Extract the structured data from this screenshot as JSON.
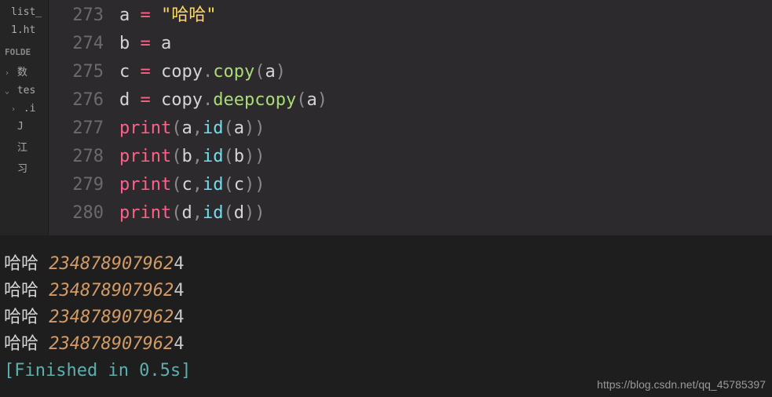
{
  "sidebar": {
    "items": [
      {
        "label": "list_",
        "type": "file"
      },
      {
        "label": "1.ht",
        "type": "file"
      },
      {
        "label": "FOLDE",
        "type": "header"
      },
      {
        "label": "数",
        "type": "folder-closed"
      },
      {
        "label": "tes",
        "type": "folder-open"
      },
      {
        "label": ".i",
        "type": "folder-closed-nested"
      },
      {
        "label": "J",
        "type": "file-nested"
      },
      {
        "label": "江",
        "type": "file-nested"
      },
      {
        "label": "习",
        "type": "file-nested"
      }
    ]
  },
  "editor": {
    "lines": [
      {
        "num": "273",
        "tokens": [
          {
            "t": "a ",
            "c": "var"
          },
          {
            "t": "=",
            "c": "op"
          },
          {
            "t": " ",
            "c": "var"
          },
          {
            "t": "\"哈哈\"",
            "c": "str"
          }
        ]
      },
      {
        "num": "274",
        "tokens": [
          {
            "t": "b ",
            "c": "var"
          },
          {
            "t": "=",
            "c": "op"
          },
          {
            "t": " a",
            "c": "var"
          }
        ]
      },
      {
        "num": "275",
        "tokens": [
          {
            "t": "c ",
            "c": "var"
          },
          {
            "t": "=",
            "c": "op"
          },
          {
            "t": " copy",
            "c": "var"
          },
          {
            "t": ".",
            "c": "punc"
          },
          {
            "t": "copy",
            "c": "call"
          },
          {
            "t": "(",
            "c": "punc"
          },
          {
            "t": "a",
            "c": "var"
          },
          {
            "t": ")",
            "c": "punc"
          }
        ]
      },
      {
        "num": "276",
        "tokens": [
          {
            "t": "d ",
            "c": "var"
          },
          {
            "t": "=",
            "c": "op"
          },
          {
            "t": " copy",
            "c": "var"
          },
          {
            "t": ".",
            "c": "punc"
          },
          {
            "t": "deepcopy",
            "c": "call"
          },
          {
            "t": "(",
            "c": "punc"
          },
          {
            "t": "a",
            "c": "var"
          },
          {
            "t": ")",
            "c": "punc"
          }
        ]
      },
      {
        "num": "277",
        "tokens": [
          {
            "t": "print",
            "c": "print"
          },
          {
            "t": "(",
            "c": "punc"
          },
          {
            "t": "a",
            "c": "var"
          },
          {
            "t": ",",
            "c": "punc"
          },
          {
            "t": "id",
            "c": "id"
          },
          {
            "t": "(",
            "c": "punc"
          },
          {
            "t": "a",
            "c": "var"
          },
          {
            "t": "))",
            "c": "punc"
          }
        ]
      },
      {
        "num": "278",
        "tokens": [
          {
            "t": "print",
            "c": "print"
          },
          {
            "t": "(",
            "c": "punc"
          },
          {
            "t": "b",
            "c": "var"
          },
          {
            "t": ",",
            "c": "punc"
          },
          {
            "t": "id",
            "c": "id"
          },
          {
            "t": "(",
            "c": "punc"
          },
          {
            "t": "b",
            "c": "var"
          },
          {
            "t": "))",
            "c": "punc"
          }
        ]
      },
      {
        "num": "279",
        "tokens": [
          {
            "t": "print",
            "c": "print"
          },
          {
            "t": "(",
            "c": "punc"
          },
          {
            "t": "c",
            "c": "var"
          },
          {
            "t": ",",
            "c": "punc"
          },
          {
            "t": "id",
            "c": "id"
          },
          {
            "t": "(",
            "c": "punc"
          },
          {
            "t": "c",
            "c": "var"
          },
          {
            "t": "))",
            "c": "punc"
          }
        ]
      },
      {
        "num": "280",
        "tokens": [
          {
            "t": "print",
            "c": "print"
          },
          {
            "t": "(",
            "c": "punc"
          },
          {
            "t": "d",
            "c": "var"
          },
          {
            "t": ",",
            "c": "punc"
          },
          {
            "t": "id",
            "c": "id"
          },
          {
            "t": "(",
            "c": "punc"
          },
          {
            "t": "d",
            "c": "var"
          },
          {
            "t": "))",
            "c": "punc"
          }
        ]
      }
    ]
  },
  "terminal": {
    "output": [
      {
        "text": "哈哈 ",
        "num": "234878907962",
        "last": "4"
      },
      {
        "text": "哈哈 ",
        "num": "234878907962",
        "last": "4"
      },
      {
        "text": "哈哈 ",
        "num": "234878907962",
        "last": "4"
      },
      {
        "text": "哈哈 ",
        "num": "234878907962",
        "last": "4"
      }
    ],
    "status": "[Finished in 0.5s]"
  },
  "watermark": "https://blog.csdn.net/qq_45785397"
}
